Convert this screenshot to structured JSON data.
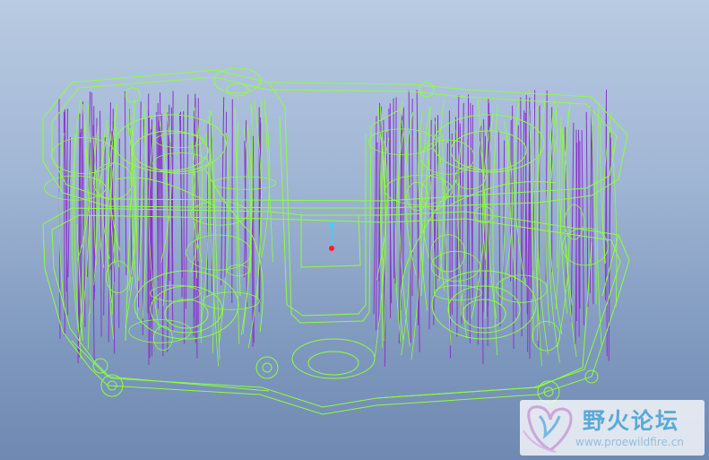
{
  "viewport": {
    "wireframe_color": "#8cff40",
    "hidden_line_color": "#8a34c8",
    "background_top": "#b9cbe2",
    "background_bottom": "#6f89b2",
    "origin_axis_color": "#2fd7ff",
    "origin_point_color": "#ff2020"
  },
  "watermark": {
    "title": "野火论坛",
    "url": "www.proewildfire.cn",
    "logo_icon": "flame-heart-logo"
  }
}
